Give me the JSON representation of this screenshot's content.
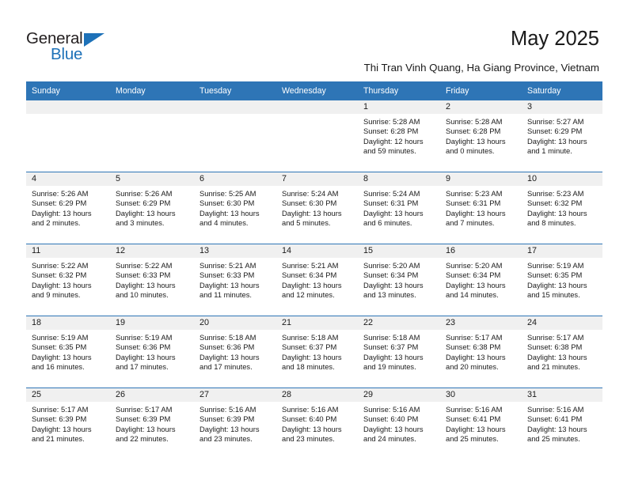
{
  "brand": {
    "name_part1": "General",
    "name_part2": "Blue",
    "accent_color": "#1d71b8"
  },
  "header": {
    "month_title": "May 2025",
    "location": "Thi Tran Vinh Quang, Ha Giang Province, Vietnam"
  },
  "calendar": {
    "header_bg": "#2e75b6",
    "daynum_bg": "#f0f0f0",
    "weekday_headers": [
      "Sunday",
      "Monday",
      "Tuesday",
      "Wednesday",
      "Thursday",
      "Friday",
      "Saturday"
    ],
    "weeks": [
      [
        {
          "day": "",
          "sunrise": "",
          "sunset": "",
          "daylight": "",
          "empty": true
        },
        {
          "day": "",
          "sunrise": "",
          "sunset": "",
          "daylight": "",
          "empty": true
        },
        {
          "day": "",
          "sunrise": "",
          "sunset": "",
          "daylight": "",
          "empty": true
        },
        {
          "day": "",
          "sunrise": "",
          "sunset": "",
          "daylight": "",
          "empty": true
        },
        {
          "day": "1",
          "sunrise": "Sunrise: 5:28 AM",
          "sunset": "Sunset: 6:28 PM",
          "daylight": "Daylight: 12 hours and 59 minutes."
        },
        {
          "day": "2",
          "sunrise": "Sunrise: 5:28 AM",
          "sunset": "Sunset: 6:28 PM",
          "daylight": "Daylight: 13 hours and 0 minutes."
        },
        {
          "day": "3",
          "sunrise": "Sunrise: 5:27 AM",
          "sunset": "Sunset: 6:29 PM",
          "daylight": "Daylight: 13 hours and 1 minute."
        }
      ],
      [
        {
          "day": "4",
          "sunrise": "Sunrise: 5:26 AM",
          "sunset": "Sunset: 6:29 PM",
          "daylight": "Daylight: 13 hours and 2 minutes."
        },
        {
          "day": "5",
          "sunrise": "Sunrise: 5:26 AM",
          "sunset": "Sunset: 6:29 PM",
          "daylight": "Daylight: 13 hours and 3 minutes."
        },
        {
          "day": "6",
          "sunrise": "Sunrise: 5:25 AM",
          "sunset": "Sunset: 6:30 PM",
          "daylight": "Daylight: 13 hours and 4 minutes."
        },
        {
          "day": "7",
          "sunrise": "Sunrise: 5:24 AM",
          "sunset": "Sunset: 6:30 PM",
          "daylight": "Daylight: 13 hours and 5 minutes."
        },
        {
          "day": "8",
          "sunrise": "Sunrise: 5:24 AM",
          "sunset": "Sunset: 6:31 PM",
          "daylight": "Daylight: 13 hours and 6 minutes."
        },
        {
          "day": "9",
          "sunrise": "Sunrise: 5:23 AM",
          "sunset": "Sunset: 6:31 PM",
          "daylight": "Daylight: 13 hours and 7 minutes."
        },
        {
          "day": "10",
          "sunrise": "Sunrise: 5:23 AM",
          "sunset": "Sunset: 6:32 PM",
          "daylight": "Daylight: 13 hours and 8 minutes."
        }
      ],
      [
        {
          "day": "11",
          "sunrise": "Sunrise: 5:22 AM",
          "sunset": "Sunset: 6:32 PM",
          "daylight": "Daylight: 13 hours and 9 minutes."
        },
        {
          "day": "12",
          "sunrise": "Sunrise: 5:22 AM",
          "sunset": "Sunset: 6:33 PM",
          "daylight": "Daylight: 13 hours and 10 minutes."
        },
        {
          "day": "13",
          "sunrise": "Sunrise: 5:21 AM",
          "sunset": "Sunset: 6:33 PM",
          "daylight": "Daylight: 13 hours and 11 minutes."
        },
        {
          "day": "14",
          "sunrise": "Sunrise: 5:21 AM",
          "sunset": "Sunset: 6:34 PM",
          "daylight": "Daylight: 13 hours and 12 minutes."
        },
        {
          "day": "15",
          "sunrise": "Sunrise: 5:20 AM",
          "sunset": "Sunset: 6:34 PM",
          "daylight": "Daylight: 13 hours and 13 minutes."
        },
        {
          "day": "16",
          "sunrise": "Sunrise: 5:20 AM",
          "sunset": "Sunset: 6:34 PM",
          "daylight": "Daylight: 13 hours and 14 minutes."
        },
        {
          "day": "17",
          "sunrise": "Sunrise: 5:19 AM",
          "sunset": "Sunset: 6:35 PM",
          "daylight": "Daylight: 13 hours and 15 minutes."
        }
      ],
      [
        {
          "day": "18",
          "sunrise": "Sunrise: 5:19 AM",
          "sunset": "Sunset: 6:35 PM",
          "daylight": "Daylight: 13 hours and 16 minutes."
        },
        {
          "day": "19",
          "sunrise": "Sunrise: 5:19 AM",
          "sunset": "Sunset: 6:36 PM",
          "daylight": "Daylight: 13 hours and 17 minutes."
        },
        {
          "day": "20",
          "sunrise": "Sunrise: 5:18 AM",
          "sunset": "Sunset: 6:36 PM",
          "daylight": "Daylight: 13 hours and 17 minutes."
        },
        {
          "day": "21",
          "sunrise": "Sunrise: 5:18 AM",
          "sunset": "Sunset: 6:37 PM",
          "daylight": "Daylight: 13 hours and 18 minutes."
        },
        {
          "day": "22",
          "sunrise": "Sunrise: 5:18 AM",
          "sunset": "Sunset: 6:37 PM",
          "daylight": "Daylight: 13 hours and 19 minutes."
        },
        {
          "day": "23",
          "sunrise": "Sunrise: 5:17 AM",
          "sunset": "Sunset: 6:38 PM",
          "daylight": "Daylight: 13 hours and 20 minutes."
        },
        {
          "day": "24",
          "sunrise": "Sunrise: 5:17 AM",
          "sunset": "Sunset: 6:38 PM",
          "daylight": "Daylight: 13 hours and 21 minutes."
        }
      ],
      [
        {
          "day": "25",
          "sunrise": "Sunrise: 5:17 AM",
          "sunset": "Sunset: 6:39 PM",
          "daylight": "Daylight: 13 hours and 21 minutes."
        },
        {
          "day": "26",
          "sunrise": "Sunrise: 5:17 AM",
          "sunset": "Sunset: 6:39 PM",
          "daylight": "Daylight: 13 hours and 22 minutes."
        },
        {
          "day": "27",
          "sunrise": "Sunrise: 5:16 AM",
          "sunset": "Sunset: 6:39 PM",
          "daylight": "Daylight: 13 hours and 23 minutes."
        },
        {
          "day": "28",
          "sunrise": "Sunrise: 5:16 AM",
          "sunset": "Sunset: 6:40 PM",
          "daylight": "Daylight: 13 hours and 23 minutes."
        },
        {
          "day": "29",
          "sunrise": "Sunrise: 5:16 AM",
          "sunset": "Sunset: 6:40 PM",
          "daylight": "Daylight: 13 hours and 24 minutes."
        },
        {
          "day": "30",
          "sunrise": "Sunrise: 5:16 AM",
          "sunset": "Sunset: 6:41 PM",
          "daylight": "Daylight: 13 hours and 25 minutes."
        },
        {
          "day": "31",
          "sunrise": "Sunrise: 5:16 AM",
          "sunset": "Sunset: 6:41 PM",
          "daylight": "Daylight: 13 hours and 25 minutes."
        }
      ]
    ]
  }
}
